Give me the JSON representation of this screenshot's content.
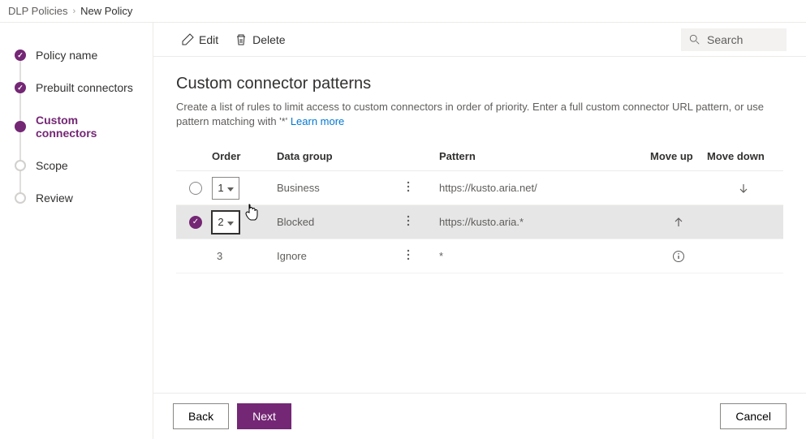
{
  "breadcrumb": {
    "parent": "DLP Policies",
    "current": "New Policy"
  },
  "steps": [
    {
      "label": "Policy name",
      "state": "done"
    },
    {
      "label": "Prebuilt connectors",
      "state": "done"
    },
    {
      "label": "Custom connectors",
      "state": "current"
    },
    {
      "label": "Scope",
      "state": "pending"
    },
    {
      "label": "Review",
      "state": "pending"
    }
  ],
  "toolbar": {
    "edit": "Edit",
    "delete": "Delete",
    "search_placeholder": "Search"
  },
  "page": {
    "title": "Custom connector patterns",
    "desc_prefix": "Create a list of rules to limit access to custom connectors in order of priority. Enter a full custom connector URL pattern, or use pattern matching with '*' ",
    "learn_more": "Learn more"
  },
  "columns": {
    "order": "Order",
    "data_group": "Data group",
    "pattern": "Pattern",
    "move_up": "Move up",
    "move_down": "Move down"
  },
  "rows": [
    {
      "order": "1",
      "data_group": "Business",
      "pattern": "https://kusto.aria.net/",
      "selected": false,
      "order_editable": true,
      "can_up": false,
      "can_down": true,
      "info": false
    },
    {
      "order": "2",
      "data_group": "Blocked",
      "pattern": "https://kusto.aria.*",
      "selected": true,
      "order_editable": true,
      "order_focused": true,
      "can_up": true,
      "can_down": false,
      "info": false
    },
    {
      "order": "3",
      "data_group": "Ignore",
      "pattern": "*",
      "selected": false,
      "order_editable": false,
      "can_up": false,
      "can_down": false,
      "info": true
    }
  ],
  "footer": {
    "back": "Back",
    "next": "Next",
    "cancel": "Cancel"
  }
}
